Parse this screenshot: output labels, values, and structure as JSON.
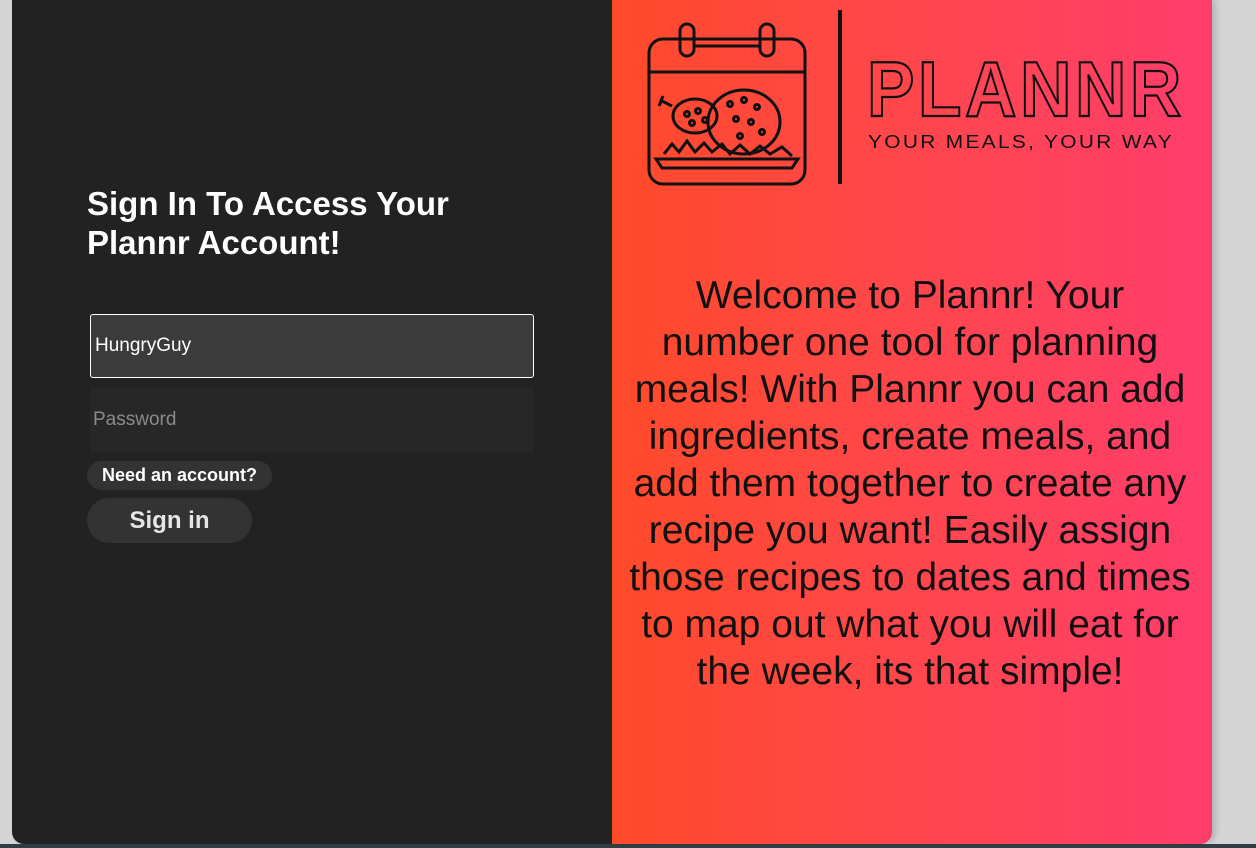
{
  "login": {
    "heading": "Sign In To Access Your Plannr Account!",
    "username_value": "HungryGuy",
    "password_placeholder": "Password",
    "need_account_label": "Need an account?",
    "signin_label": "Sign in"
  },
  "brand": {
    "name": "PLANNR",
    "tagline": "YOUR MEALS, YOUR WAY",
    "logo_icon": "calendar-meal-icon"
  },
  "welcome": {
    "text": "Welcome to Plannr! Your number one tool for planning meals! With Plannr you can add ingredients, create meals, and add them together to create any recipe you want! Easily assign those recipes to dates and times to map out what you will eat for the week, its that simple!"
  },
  "colors": {
    "left_panel": "#222222",
    "gradient_start": "#ff4a2a",
    "gradient_end": "#ff3d6c",
    "input_active": "#3b3b3b",
    "button_bg": "#333333"
  }
}
